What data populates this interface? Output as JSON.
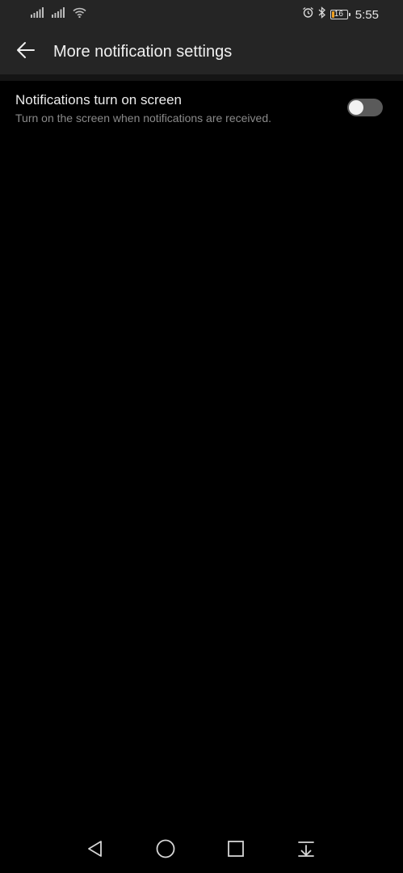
{
  "status_bar": {
    "time": "5:55",
    "battery_level": "16",
    "icons": [
      "signal-icon",
      "signal-icon",
      "wifi-icon",
      "alarm-icon",
      "bluetooth-icon",
      "battery-icon"
    ]
  },
  "app_bar": {
    "title": "More notification settings",
    "back_icon": "back-arrow-icon"
  },
  "settings": [
    {
      "title": "Notifications turn on screen",
      "subtitle": "Turn on the screen when notifications are received.",
      "enabled": false
    }
  ],
  "nav_bar": {
    "icons": [
      "back-triangle-icon",
      "home-circle-icon",
      "recents-square-icon",
      "notification-pull-icon"
    ]
  },
  "colors": {
    "background": "#000000",
    "bar": "#252525",
    "toggle_off": "#5a5a5a",
    "battery_accent": "#f0a020"
  }
}
